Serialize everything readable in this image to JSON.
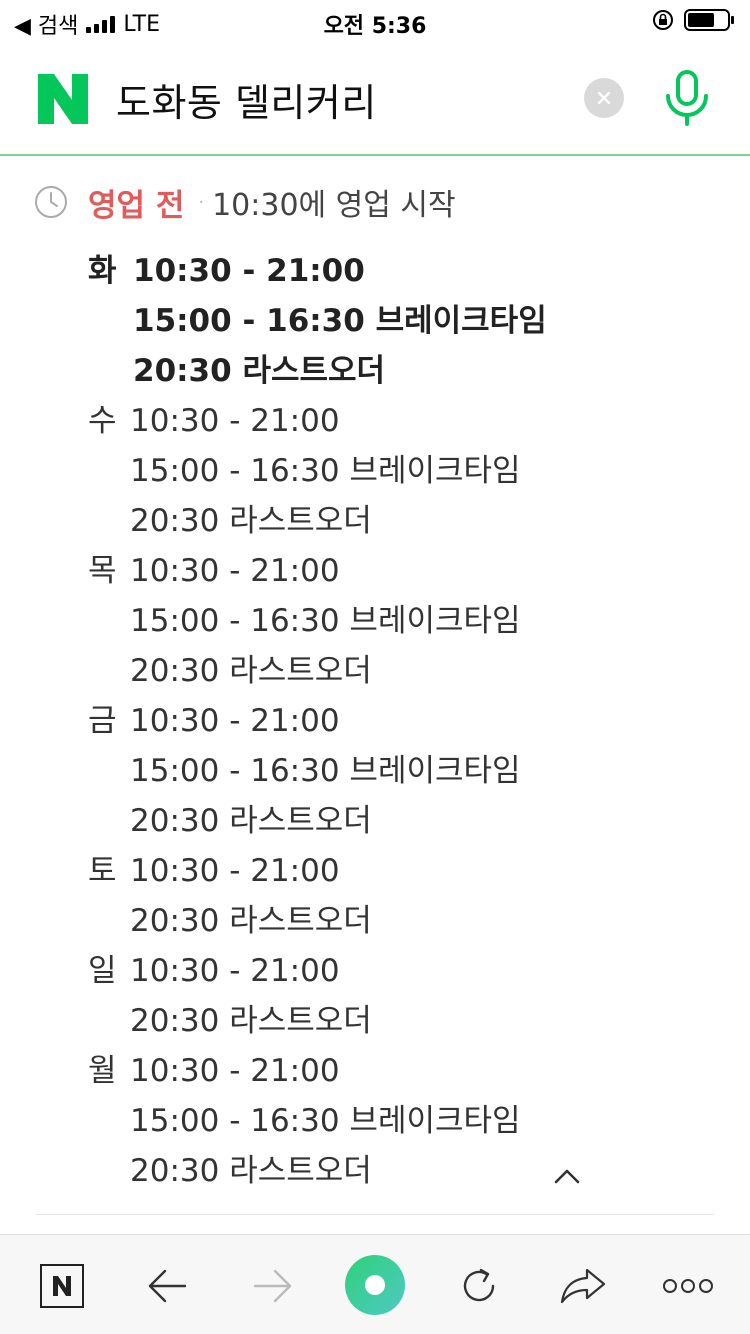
{
  "status_bar": {
    "back_label": "◀ 검색",
    "carrier": "LTE",
    "time": "오전 5:36"
  },
  "search": {
    "query": "도화동 델리커리",
    "brand_color": "#03c75a"
  },
  "business_status": {
    "status": "영업 전",
    "separator": "·",
    "open_note": "10:30에 영업 시작",
    "status_color": "#e25b5b"
  },
  "hours": [
    {
      "day": "화",
      "today": true,
      "lines": [
        "10:30 - 21:00",
        "15:00 - 16:30 브레이크타임",
        "20:30 라스트오더"
      ]
    },
    {
      "day": "수",
      "today": false,
      "lines": [
        "10:30 - 21:00",
        "15:00 - 16:30 브레이크타임",
        "20:30 라스트오더"
      ]
    },
    {
      "day": "목",
      "today": false,
      "lines": [
        "10:30 - 21:00",
        "15:00 - 16:30 브레이크타임",
        "20:30 라스트오더"
      ]
    },
    {
      "day": "금",
      "today": false,
      "lines": [
        "10:30 - 21:00",
        "15:00 - 16:30 브레이크타임",
        "20:30 라스트오더"
      ]
    },
    {
      "day": "토",
      "today": false,
      "lines": [
        "10:30 - 21:00",
        "20:30 라스트오더"
      ]
    },
    {
      "day": "일",
      "today": false,
      "lines": [
        "10:30 - 21:00",
        "20:30 라스트오더"
      ]
    },
    {
      "day": "월",
      "today": false,
      "lines": [
        "10:30 - 21:00",
        "15:00 - 16:30 브레이크타임",
        "20:30 라스트오더"
      ]
    }
  ],
  "toolbar": {
    "icons": [
      "naver-home-icon",
      "back-arrow-icon",
      "forward-arrow-icon",
      "green-dot-icon",
      "refresh-icon",
      "share-icon",
      "more-icon"
    ]
  }
}
